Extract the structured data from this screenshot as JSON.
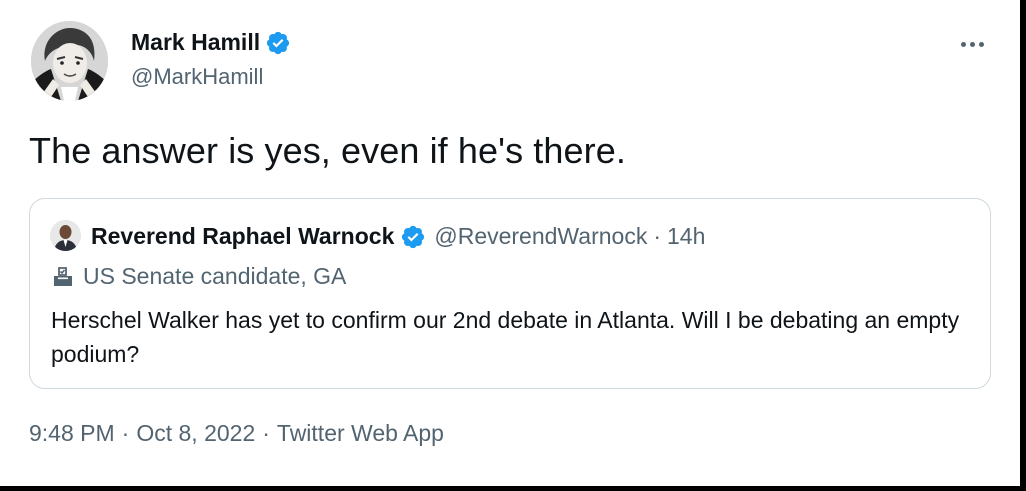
{
  "author": {
    "name": "Mark Hamill",
    "handle": "@MarkHamill",
    "verified": true
  },
  "tweet": {
    "text": "The answer is yes, even if he's there."
  },
  "quoted": {
    "name": "Reverend Raphael Warnock",
    "handle": "@ReverendWarnock",
    "separator": "·",
    "time": "14h",
    "label": "US Senate candidate, GA",
    "label_icon": "ballot-box-icon",
    "text": "Herschel Walker has yet to confirm our 2nd debate in Atlanta. Will I be debating an empty podium?"
  },
  "meta": {
    "time": "9:48 PM",
    "date": "Oct 8, 2022",
    "separator": "·",
    "source": "Twitter Web App"
  },
  "icons": {
    "verified": "verified-badge-icon",
    "more": "more-options-icon"
  },
  "colors": {
    "verified": "#1d9bf0",
    "text": "#0f1419",
    "secondary": "#536471",
    "border": "#cfd9de"
  }
}
